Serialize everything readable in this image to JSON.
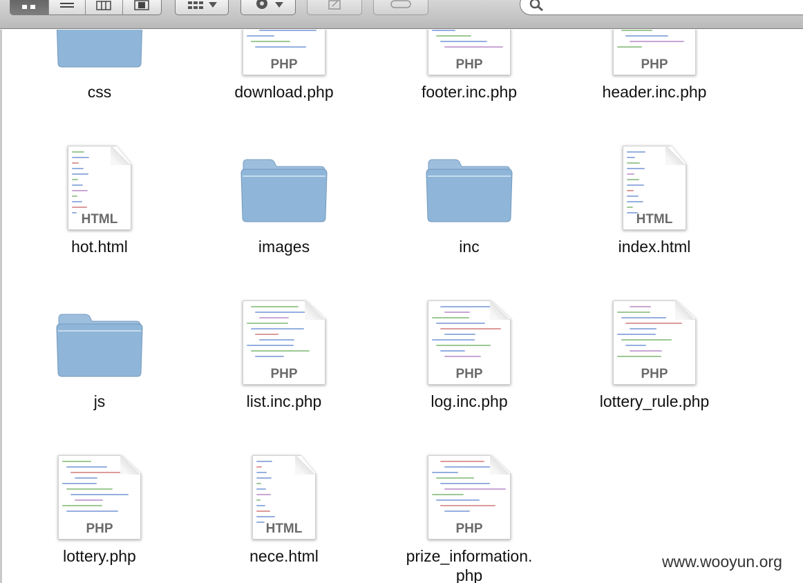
{
  "toolbar": {
    "view_buttons": [
      "icon-view",
      "list-view",
      "column-view",
      "coverflow-view"
    ],
    "active_view": "icon-view",
    "arrange_icon": "grid-icon",
    "action_icon": "gear-icon",
    "share_icon": "share-icon",
    "tag_icon": "tag-icon",
    "search": {
      "placeholder": "",
      "value": ""
    }
  },
  "files": [
    {
      "name": "css",
      "kind": "folder"
    },
    {
      "name": "download.php",
      "kind": "php"
    },
    {
      "name": "footer.inc.php",
      "kind": "php"
    },
    {
      "name": "header.inc.php",
      "kind": "php"
    },
    {
      "name": "hot.html",
      "kind": "html"
    },
    {
      "name": "images",
      "kind": "folder"
    },
    {
      "name": "inc",
      "kind": "folder"
    },
    {
      "name": "index.html",
      "kind": "html"
    },
    {
      "name": "js",
      "kind": "folder"
    },
    {
      "name": "list.inc.php",
      "kind": "php"
    },
    {
      "name": "log.inc.php",
      "kind": "php"
    },
    {
      "name": "lottery_rule.php",
      "kind": "php"
    },
    {
      "name": "lottery.php",
      "kind": "php"
    },
    {
      "name": "nece.html",
      "kind": "html"
    },
    {
      "name": "prize_information.\nphp",
      "kind": "php"
    }
  ],
  "doc_type_labels": {
    "php": "PHP",
    "html": "HTML"
  },
  "watermark": "www.wooyun.org",
  "colors": {
    "folder": "#8fb6d8",
    "toolbar": "#c8c8c8",
    "code_blue": "#3d6cc4",
    "code_green": "#4a9a3a"
  }
}
